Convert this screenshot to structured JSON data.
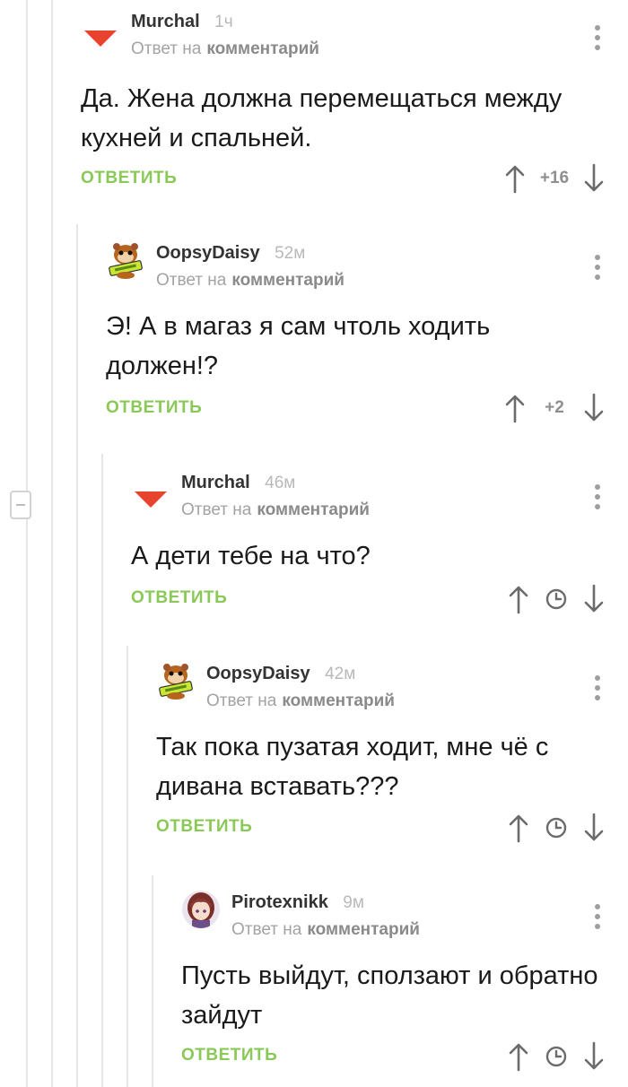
{
  "comments": [
    {
      "author": "Murchal",
      "time": "1ч",
      "reply_prefix": "Ответ на",
      "reply_link": "комментарий",
      "text": "Да. Жена должна перемещаться между\nкухней и спальней.",
      "reply_label": "ОТВЕТИТЬ",
      "rating": "+16",
      "avatar": "red-triangle-icon"
    },
    {
      "author": "OopsyDaisy",
      "time": "52м",
      "reply_prefix": "Ответ на",
      "reply_link": "комментарий",
      "text": "Э! А в магаз я сам чтоль ходить\nдолжен!?",
      "reply_label": "ОТВЕТИТЬ",
      "rating": "+2",
      "avatar": "hamster-avatar"
    },
    {
      "author": "Murchal",
      "time": "46м",
      "reply_prefix": "Ответ на",
      "reply_link": "комментарий",
      "text": "А дети тебе на что?",
      "reply_label": "ОТВЕТИТЬ",
      "avatar": "red-triangle-icon"
    },
    {
      "author": "OopsyDaisy",
      "time": "42м",
      "reply_prefix": "Ответ на",
      "reply_link": "комментарий",
      "text": "Так пока пузатая ходит, мне чё с\nдивана вставать???",
      "reply_label": "ОТВЕТИТЬ",
      "avatar": "hamster-avatar"
    },
    {
      "author": "Pirotexnikk",
      "time": "9м",
      "reply_prefix": "Ответ на",
      "reply_link": "комментарий",
      "text": "Пусть выйдут, сползают и обратно\nзайдут",
      "reply_label": "ОТВЕТИТЬ",
      "avatar": "anime-girl-avatar"
    }
  ],
  "colors": {
    "reply_green": "#8ac858",
    "avatar_red": "#e8432f",
    "thread_line": "#e6e6e6"
  },
  "icons": {
    "collapse": "minus-icon",
    "upvote": "arrow-up-icon",
    "downvote": "arrow-down-icon",
    "pending": "clock-icon",
    "menu": "more-vertical-icon"
  }
}
